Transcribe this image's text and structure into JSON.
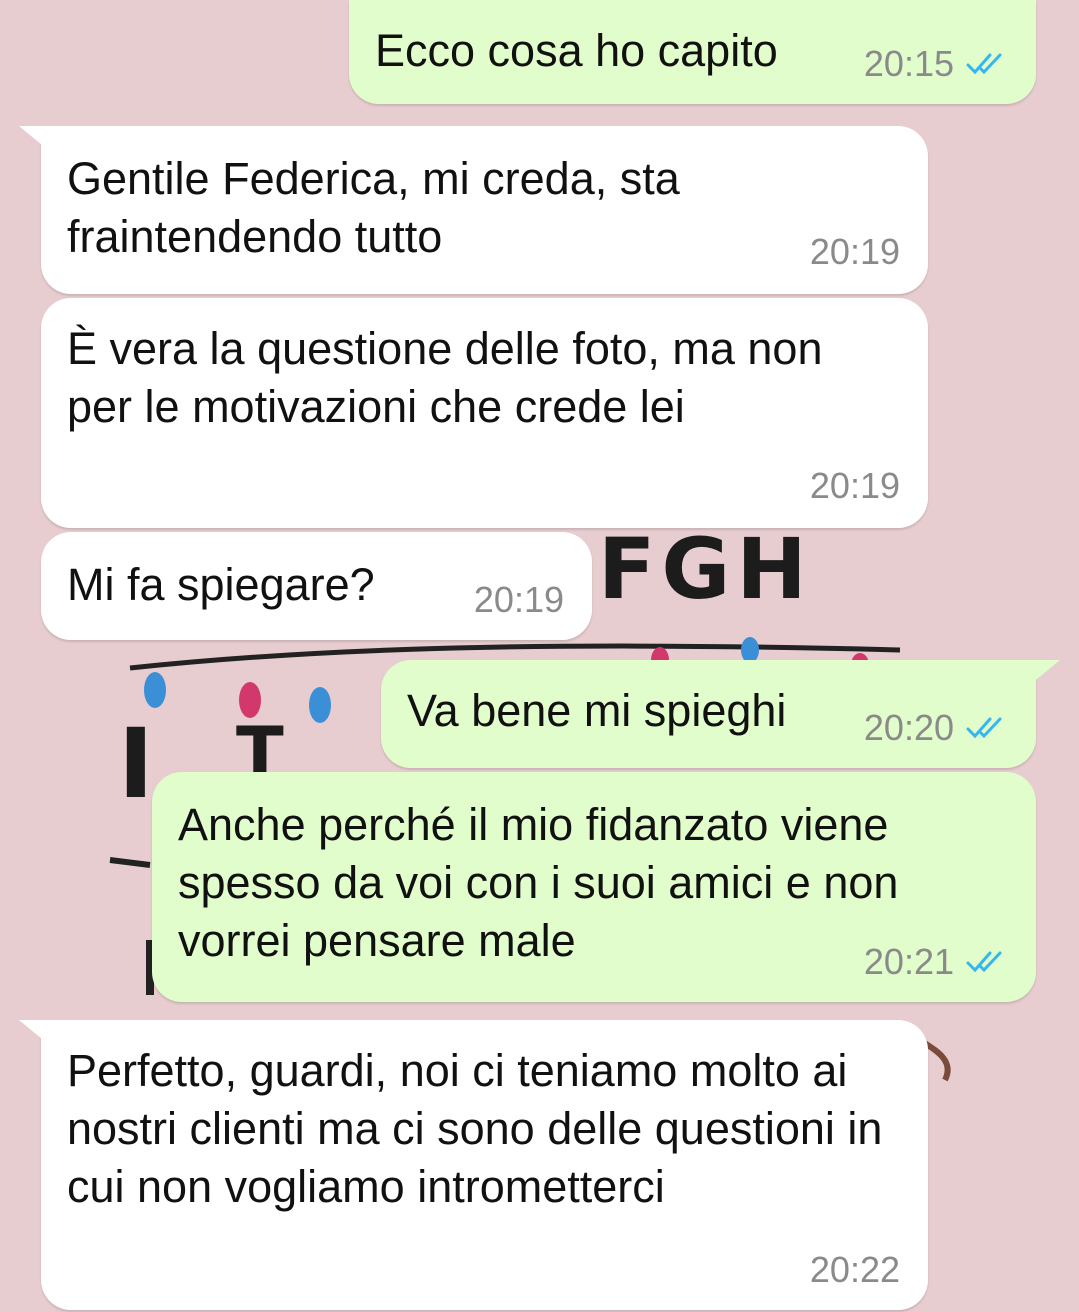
{
  "chat": {
    "messages": [
      {
        "direction": "outgoing",
        "text": "Ecco cosa ho capito",
        "time": "20:15",
        "status_icon": "double-check-read-icon"
      },
      {
        "direction": "incoming",
        "text": "Gentile Federica, mi creda, sta fraintendendo tutto",
        "time": "20:19"
      },
      {
        "direction": "incoming",
        "text": "È vera la questione delle foto, ma non per le motivazioni che crede lei",
        "time": "20:19"
      },
      {
        "direction": "incoming",
        "text": "Mi fa spiegare?",
        "time": "20:19"
      },
      {
        "direction": "outgoing",
        "text": "Va bene mi spieghi",
        "time": "20:20",
        "status_icon": "double-check-read-icon"
      },
      {
        "direction": "outgoing",
        "text": "Anche perché il mio fidanzato viene spesso da voi con i suoi amici e non vorrei pensare male",
        "time": "20:21",
        "status_icon": "double-check-read-icon"
      },
      {
        "direction": "incoming",
        "text": "Perfetto, guardi, noi ci teniamo molto ai nostri clienti ma ci sono delle questioni in cui non vogliamo intrometterci",
        "time": "20:22"
      }
    ]
  },
  "wallpaper": {
    "letters_text": "FGH",
    "letter_i": "I",
    "letter_t": "T"
  },
  "colors": {
    "background": "#e8cdd0",
    "incoming_bubble": "#ffffff",
    "outgoing_bubble": "#e2fdcc",
    "read_check": "#34b7f1",
    "timestamp": "#8a8a8a"
  }
}
